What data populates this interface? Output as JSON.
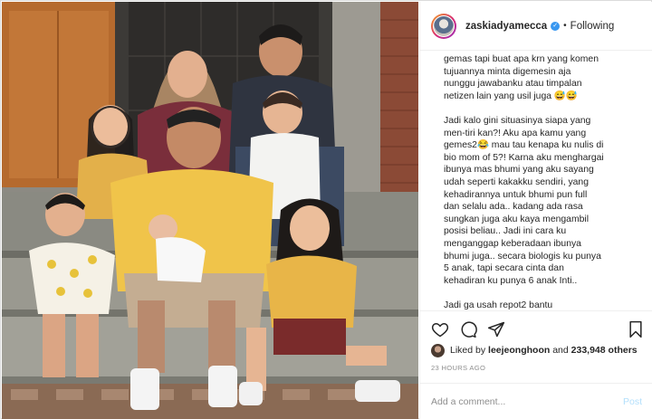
{
  "post": {
    "photo_alt": "",
    "header": {
      "username": "zaskiadyamecca",
      "verified_mark": "✓",
      "separator": "•",
      "follow_status": "Following"
    },
    "caption": {
      "paragraphs": [
        "gemas tapi buat apa krn yang komen\ntujuannya minta digemesin aja\nnunggu jawabanku atau timpalan\nnetizen lain yang usil juga 😅😅",
        "Jadi kalo gini situasinya siapa yang\nmen-tiri kan?! Aku apa kamu yang\ngemes2😂 mau tau kenapa ku nulis di\nbio mom of 5?! Karna aku menghargai\nibunya mas bhumi yang aku sayang\nudah seperti kakakku sendiri, yang\nkehadirannya untuk bhumi pun full\ndan selalu ada.. kadang ada rasa\nsungkan juga aku kaya mengambil\nposisi beliau.. Jadi ini cara ku\nmenganggap keberadaan ibunya\nbhumi juga.. secara biologis ku punya\n5 anak, tapi secara cinta dan\nkehadiran ku punya 6 anak Inti..",
        "Jadi ga usah repot2 bantu"
      ]
    },
    "likes": {
      "prefix": "Liked by",
      "first_liker": "leejeonghoon",
      "conjunction": "and",
      "others": "233,948 others"
    },
    "timestamp": "23 HOURS AGO",
    "comment": {
      "placeholder": "Add a comment...",
      "post_label": "Post"
    },
    "icons": [
      "heart-icon",
      "comment-icon",
      "share-icon",
      "bookmark-icon",
      "verified-icon"
    ],
    "colors": {
      "link_blue": "#3897f0",
      "post_disabled": "#b2dffc",
      "muted": "#8e8e8e",
      "border": "#efefef"
    }
  }
}
